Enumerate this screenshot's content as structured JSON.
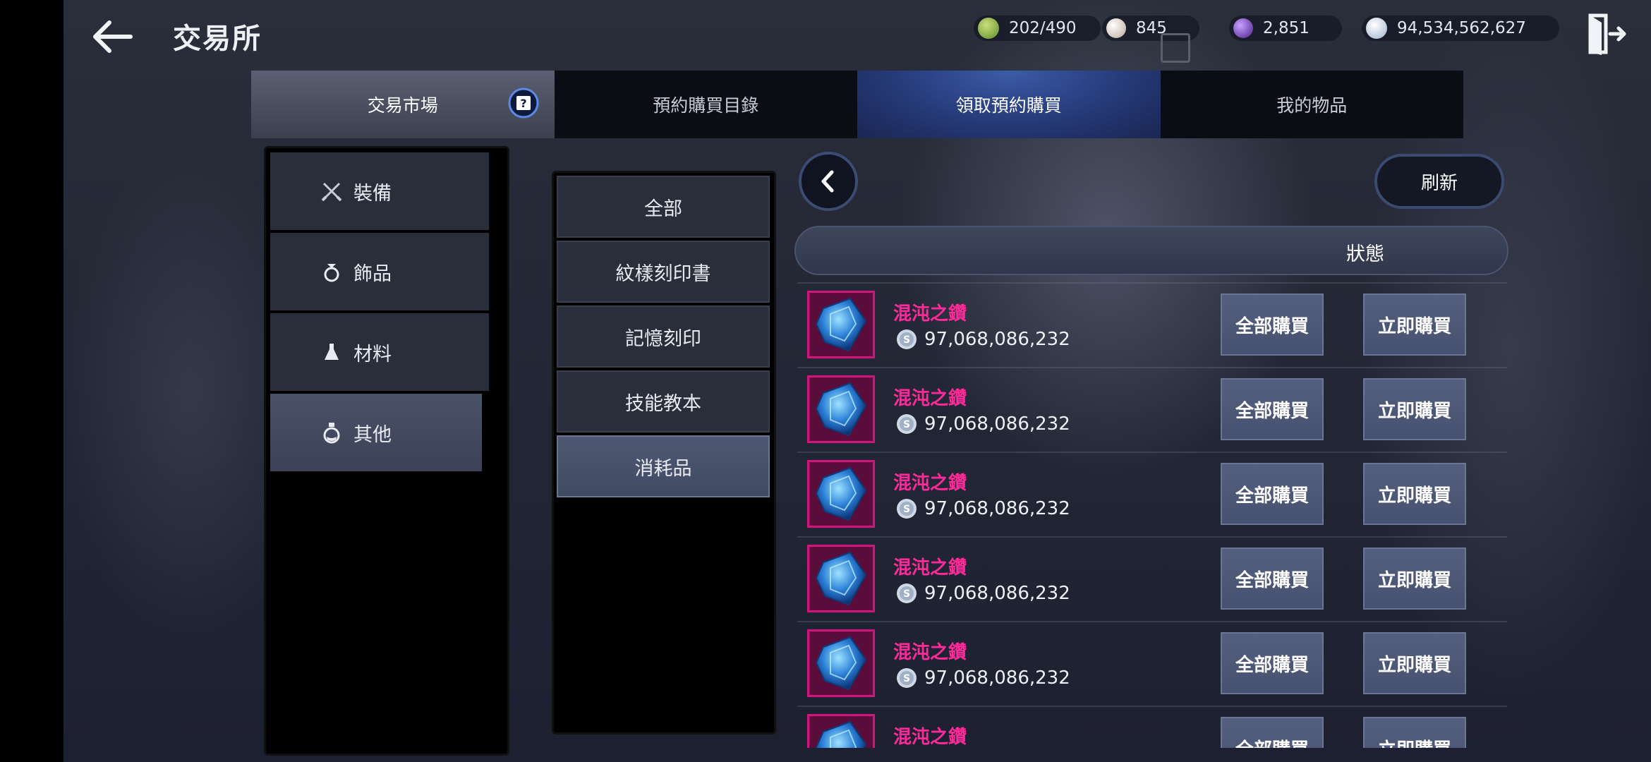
{
  "header": {
    "title": "交易所",
    "currencies": [
      {
        "icon": "green-gem-icon",
        "color": "#7fae4a",
        "value": "202/490"
      },
      {
        "icon": "pearl-icon",
        "color": "#d7c9bd",
        "value": "845"
      },
      {
        "icon": "purple-orb-icon",
        "color": "#7a3fc0",
        "value": "2,851"
      },
      {
        "icon": "silver-coin-icon",
        "color": "#c9d8ea",
        "value": "94,534,562,627"
      }
    ]
  },
  "tabs": [
    "交易市場",
    "預約購買目錄",
    "領取預約購買",
    "我的物品"
  ],
  "categories": [
    {
      "label": "裝備",
      "icon": "crossed-swords-icon"
    },
    {
      "label": "飾品",
      "icon": "ring-icon"
    },
    {
      "label": "材料",
      "icon": "flask-icon"
    },
    {
      "label": "其他",
      "icon": "potion-icon"
    }
  ],
  "subcategories": [
    "全部",
    "紋樣刻印書",
    "記憶刻印",
    "技能教本",
    "消耗品"
  ],
  "toolbar": {
    "refresh_label": "刷新"
  },
  "list_header": {
    "status_label": "狀態"
  },
  "items": [
    {
      "name": "混沌之鑽",
      "price": "97,068,086,232",
      "buy_all": "全部購買",
      "buy_now": "立即購買"
    },
    {
      "name": "混沌之鑽",
      "price": "97,068,086,232",
      "buy_all": "全部購買",
      "buy_now": "立即購買"
    },
    {
      "name": "混沌之鑽",
      "price": "97,068,086,232",
      "buy_all": "全部購買",
      "buy_now": "立即購買"
    },
    {
      "name": "混沌之鑽",
      "price": "97,068,086,232",
      "buy_all": "全部購買",
      "buy_now": "立即購買"
    },
    {
      "name": "混沌之鑽",
      "price": "97,068,086,232",
      "buy_all": "全部購買",
      "buy_now": "立即購買"
    },
    {
      "name": "混沌之鑽",
      "price": "",
      "buy_all": "全部購買",
      "buy_now": "立即購買"
    }
  ],
  "colors": {
    "item_name": "#ff2a9a",
    "accent": "#3b4a70",
    "selected_tab": "#253a78"
  }
}
